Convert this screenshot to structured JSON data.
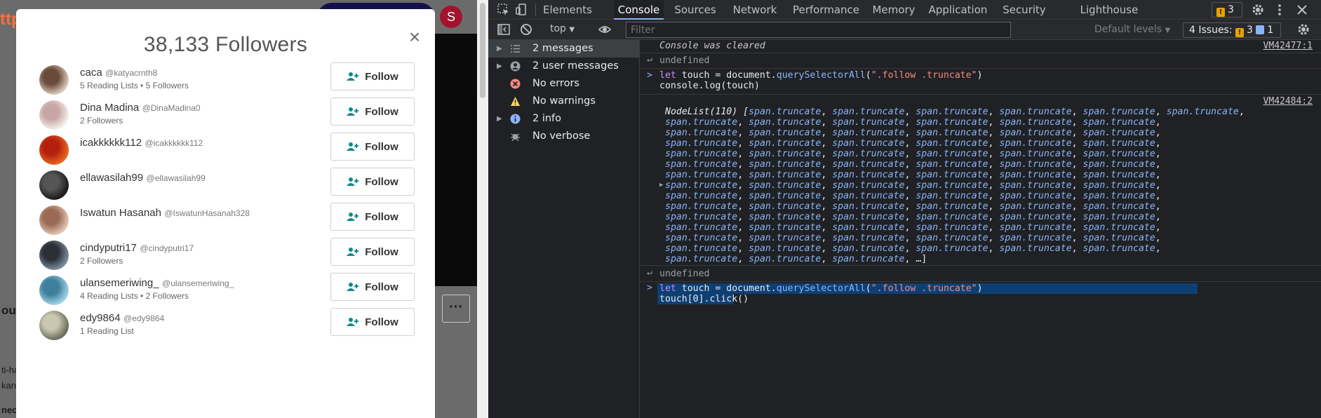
{
  "background": {
    "url_fragment": "ttp",
    "avatar_letter": "S",
    "more_label": "···",
    "text_fragments": [
      "out",
      "ti-ha",
      "kan",
      "nec"
    ]
  },
  "modal": {
    "title": "38,133 Followers",
    "close_label": "×",
    "follow_label": "Follow",
    "followers": [
      {
        "name": "caca",
        "handle": "@katyacrnth8",
        "meta": "5 Reading Lists • 5 Followers"
      },
      {
        "name": "Dina Madina",
        "handle": "@DinaMadina0",
        "meta": "2 Followers"
      },
      {
        "name": "icakkkkkk112",
        "handle": "@icakkkkkk112",
        "meta": ""
      },
      {
        "name": "ellawasilah99",
        "handle": "@ellawasilah99",
        "meta": ""
      },
      {
        "name": "Iswatun Hasanah",
        "handle": "@IswatunHasanah328",
        "meta": ""
      },
      {
        "name": "cindyputri17",
        "handle": "@cindyputri17",
        "meta": "2 Followers"
      },
      {
        "name": "ulansemeriwing_",
        "handle": "@ulansemeriwing_",
        "meta": "4 Reading Lists • 2 Followers"
      },
      {
        "name": "edy9864",
        "handle": "@edy9864",
        "meta": "1 Reading List"
      }
    ]
  },
  "devtools": {
    "tabs": [
      "Elements",
      "Console",
      "Sources",
      "Network",
      "Performance",
      "Memory",
      "Application",
      "Security",
      "Lighthouse"
    ],
    "active_tab": "Console",
    "warning_count": "3",
    "context": "top",
    "filter_placeholder": "Filter",
    "levels": "Default levels",
    "issues": {
      "label": "4 Issues:",
      "warnings": "3",
      "info": "1"
    },
    "sidebar": [
      {
        "label": "2 messages",
        "icon": "list-icon",
        "arrow": true
      },
      {
        "label": "2 user messages",
        "icon": "user-icon",
        "arrow": true
      },
      {
        "label": "No errors",
        "icon": "error-icon",
        "arrow": false
      },
      {
        "label": "No warnings",
        "icon": "warning-icon",
        "arrow": false
      },
      {
        "label": "2 info",
        "icon": "info-icon",
        "arrow": true
      },
      {
        "label": "No verbose",
        "icon": "verbose-icon",
        "arrow": false
      }
    ],
    "console": {
      "cleared": "Console was cleared",
      "cleared_src": "VM42477:1",
      "undefined": "undefined",
      "cmd1_l1_a": "let",
      "cmd1_l1_b": " touch = document.",
      "cmd1_l1_c": "querySelectorAll",
      "cmd1_l1_d": "(",
      "cmd1_l1_e": "\".follow .truncate\"",
      "cmd1_l1_f": ")",
      "cmd1_l2": "console.log(touch)",
      "log_src": "VM42484:2",
      "nodelist_head": "NodeList(110) [",
      "item": "span.truncate",
      "nodelist_tail": "…]",
      "cmd2_l1_a": "let",
      "cmd2_l1_b": " touch = document.",
      "cmd2_l1_c": "querySelectorAll",
      "cmd2_l1_d": "(",
      "cmd2_l1_e": "\".follow .truncate\"",
      "cmd2_l1_f": ")",
      "cmd2_l2": "touch[0].click()"
    }
  }
}
